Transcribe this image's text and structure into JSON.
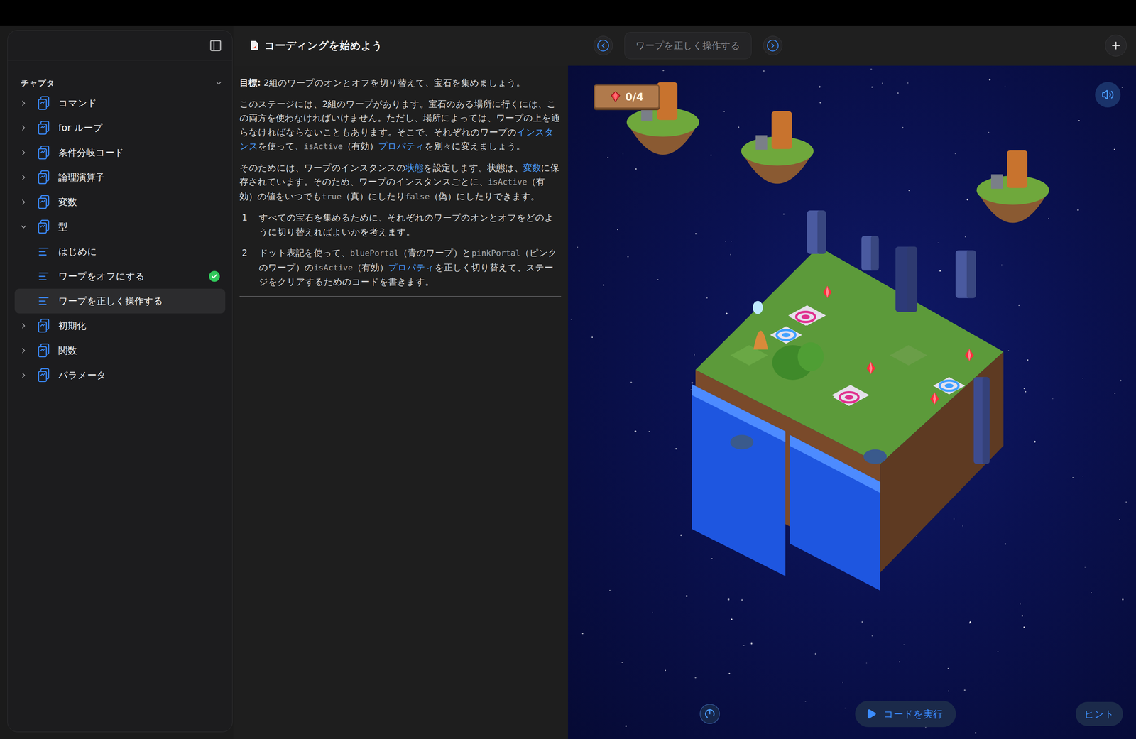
{
  "window": {
    "title": "コーディングを始めよう"
  },
  "sidebar": {
    "section": "チャプタ",
    "expanded": true,
    "chapters": [
      {
        "label": "コマンド",
        "expanded": false,
        "pages": []
      },
      {
        "label": "for ループ",
        "expanded": false,
        "pages": []
      },
      {
        "label": "条件分岐コード",
        "expanded": false,
        "pages": []
      },
      {
        "label": "論理演算子",
        "expanded": false,
        "pages": []
      },
      {
        "label": "変数",
        "expanded": false,
        "pages": []
      },
      {
        "label": "型",
        "expanded": true,
        "pages": [
          {
            "label": "はじめに",
            "completed": false,
            "selected": false
          },
          {
            "label": "ワープをオフにする",
            "completed": true,
            "selected": false
          },
          {
            "label": "ワープを正しく操作する",
            "completed": false,
            "selected": true
          }
        ]
      },
      {
        "label": "初期化",
        "expanded": false,
        "pages": []
      },
      {
        "label": "関数",
        "expanded": false,
        "pages": []
      },
      {
        "label": "パラメータ",
        "expanded": false,
        "pages": []
      }
    ]
  },
  "navigation": {
    "page_title": "ワープを正しく操作する"
  },
  "document": {
    "paragraphs": [
      [
        {
          "kind": "bold",
          "text": "目標:"
        },
        {
          "kind": "text",
          "text": " 2組のワープのオンとオフを切り替えて、宝石を集めましょう。"
        }
      ],
      [
        {
          "kind": "text",
          "text": "このステージには、2組のワープがあります。宝石のある場所に行くには、この両方を使わなければいけません。ただし、場所によっては、ワープの上を通らなければならないこともあります。そこで、それぞれのワープの"
        },
        {
          "kind": "link",
          "text": "インスタンス"
        },
        {
          "kind": "text",
          "text": "を使って、"
        },
        {
          "kind": "code",
          "text": "isActive"
        },
        {
          "kind": "text",
          "text": "（有効）"
        },
        {
          "kind": "link",
          "text": "プロパティ"
        },
        {
          "kind": "text",
          "text": "を別々に変えましょう。"
        }
      ],
      [
        {
          "kind": "text",
          "text": "そのためには、ワープのインスタンスの"
        },
        {
          "kind": "link",
          "text": "状態"
        },
        {
          "kind": "text",
          "text": "を設定します。状態は、"
        },
        {
          "kind": "link",
          "text": "変数"
        },
        {
          "kind": "text",
          "text": "に保存されています。そのため、ワープのインスタンスごとに、"
        },
        {
          "kind": "code",
          "text": "isActive"
        },
        {
          "kind": "text",
          "text": "（有効）の値をいつでも"
        },
        {
          "kind": "code",
          "text": "true"
        },
        {
          "kind": "text",
          "text": "（真）にしたり"
        },
        {
          "kind": "code",
          "text": "false"
        },
        {
          "kind": "text",
          "text": "（偽）にしたりできます。"
        }
      ]
    ],
    "steps": [
      {
        "number": "1",
        "segments": [
          {
            "kind": "text",
            "text": "すべての宝石を集めるために、それぞれのワープのオンとオフをどのように切り替えればよいかを考えます。"
          }
        ]
      },
      {
        "number": "2",
        "segments": [
          {
            "kind": "text",
            "text": "ドット表記を使って、"
          },
          {
            "kind": "code",
            "text": "bluePortal"
          },
          {
            "kind": "text",
            "text": "（青のワープ）と"
          },
          {
            "kind": "code",
            "text": "pinkPortal"
          },
          {
            "kind": "text",
            "text": "（ピンクのワープ）の"
          },
          {
            "kind": "code",
            "text": "isActive"
          },
          {
            "kind": "text",
            "text": "（有効）"
          },
          {
            "kind": "link",
            "text": "プロパティ"
          },
          {
            "kind": "text",
            "text": "を正しく切り替えて、ステージをクリアするためのコードを書きます。"
          }
        ]
      }
    ]
  },
  "game": {
    "gem_counter": "0/4",
    "sound_on": true
  },
  "buttons": {
    "run": "コードを実行",
    "hint": "ヒント"
  }
}
